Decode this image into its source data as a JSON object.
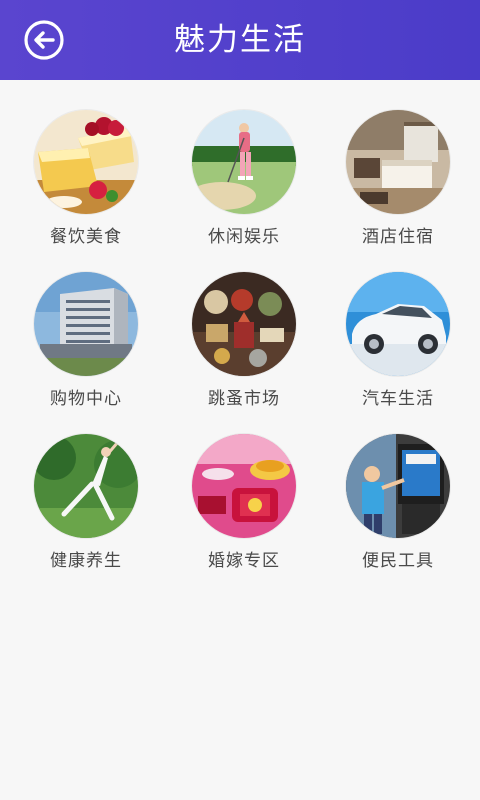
{
  "header": {
    "title": "魅力生活",
    "back_icon": "back-arrow-circle-icon",
    "background": "#5443cc"
  },
  "categories": [
    {
      "label": "餐饮美食",
      "icon": "cake-food-image"
    },
    {
      "label": "休闲娱乐",
      "icon": "golf-player-image"
    },
    {
      "label": "酒店住宿",
      "icon": "hotel-room-image"
    },
    {
      "label": "购物中心",
      "icon": "shopping-building-image"
    },
    {
      "label": "跳蚤市场",
      "icon": "antique-market-image"
    },
    {
      "label": "汽车生活",
      "icon": "white-car-image"
    },
    {
      "label": "健康养生",
      "icon": "yoga-image"
    },
    {
      "label": "婚嫁专区",
      "icon": "wedding-items-image"
    },
    {
      "label": "便民工具",
      "icon": "kiosk-kids-image"
    }
  ]
}
